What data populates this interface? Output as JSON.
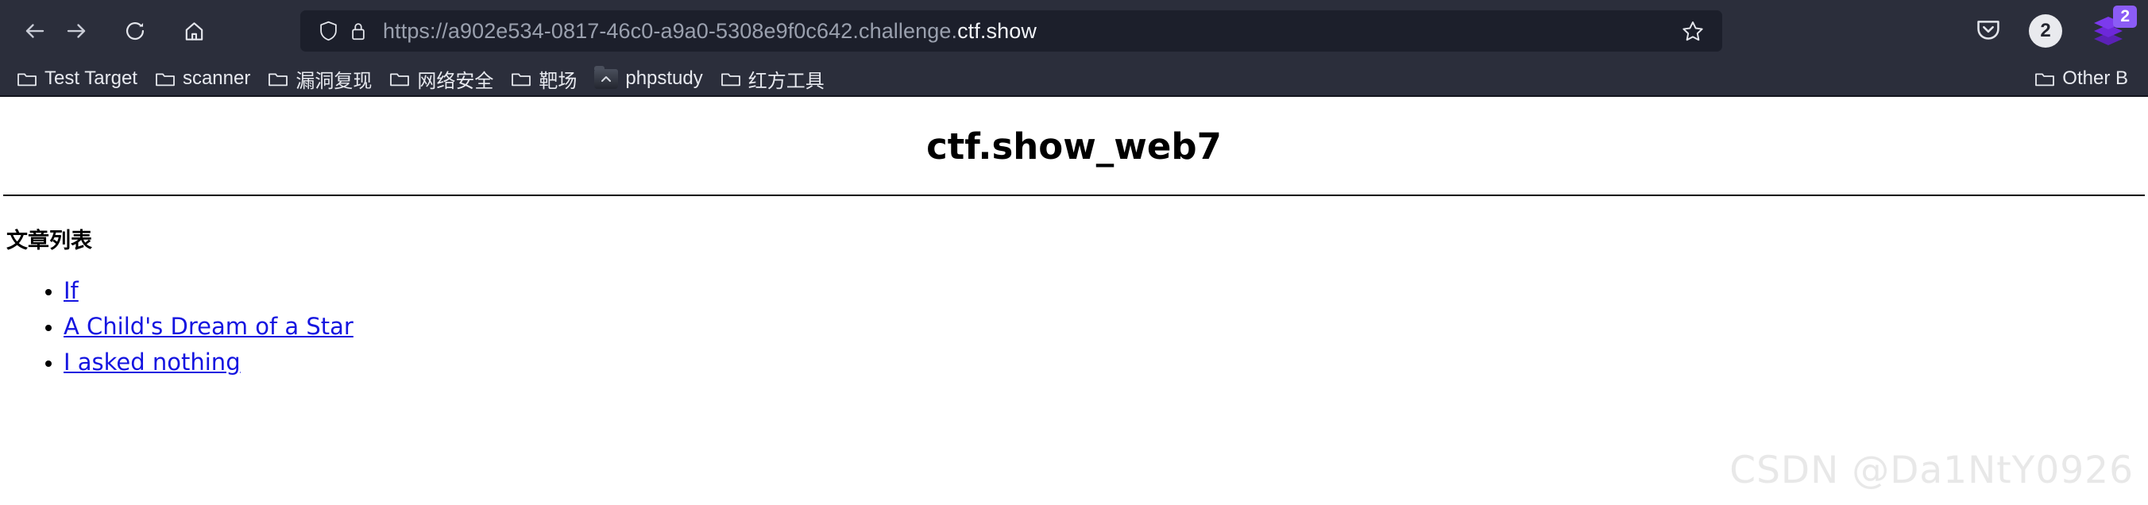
{
  "browser": {
    "nav_buttons": [
      {
        "name": "back",
        "label": "Back"
      },
      {
        "name": "forward",
        "label": "Forward"
      },
      {
        "name": "reload",
        "label": "Reload"
      },
      {
        "name": "home",
        "label": "Home"
      }
    ],
    "url_bar": {
      "url_prefix": "https://a902e534-0817-46c0-a9a0-5308e9f0c642.challenge.",
      "url_domain": "ctf.show",
      "full_url": "https://a902e534-0817-46c0-a9a0-5308e9f0c642.challenge.ctf.show",
      "shield_icon": "shield-icon",
      "lock_icon": "lock-icon",
      "star_icon": "star-icon"
    },
    "toolbar_right": {
      "pocket_icon": "pocket-icon",
      "account_badge": "2",
      "extension_badge": "2",
      "extension_color": "#8b5cf6"
    },
    "bookmarks": [
      {
        "label": "Test Target",
        "icon": "folder-icon"
      },
      {
        "label": "scanner",
        "icon": "folder-icon"
      },
      {
        "label": "漏洞复现",
        "icon": "folder-icon"
      },
      {
        "label": "网络安全",
        "icon": "folder-icon"
      },
      {
        "label": "靶场",
        "icon": "folder-icon"
      },
      {
        "label": "phpstudy",
        "icon": "phpstudy-folder-icon"
      },
      {
        "label": "红方工具",
        "icon": "folder-icon"
      }
    ],
    "other_bookmarks": {
      "label": "Other B",
      "icon": "folder-icon"
    }
  },
  "page": {
    "title": "ctf.show_web7",
    "section_label": "文章列表",
    "articles": [
      {
        "label": "If"
      },
      {
        "label": "A Child's Dream of a Star"
      },
      {
        "label": "I asked nothing"
      }
    ],
    "watermark": "CSDN @Da1NtY0926"
  },
  "colors": {
    "chrome_bg": "#2b2e3b",
    "urlbar_bg": "#1c1f2b",
    "link": "#1414e0",
    "accent_purple": "#8b5cf6"
  }
}
